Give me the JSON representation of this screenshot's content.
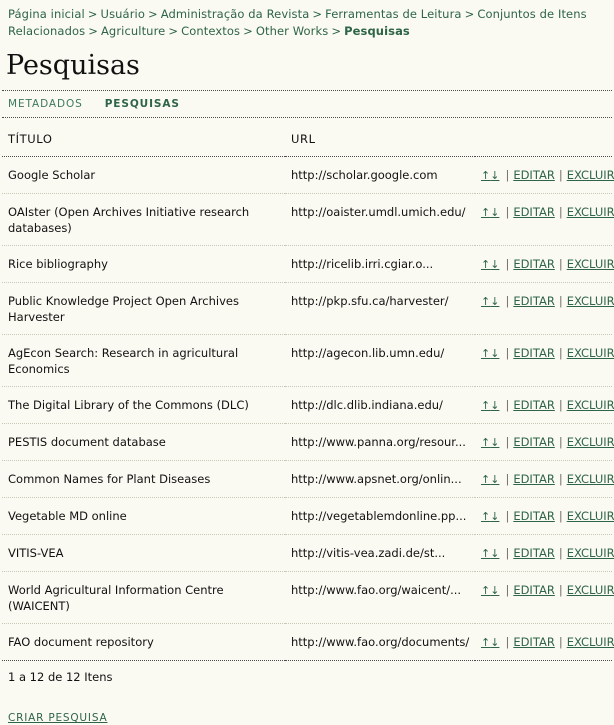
{
  "breadcrumb": {
    "separator": ">",
    "items": [
      {
        "label": "Página inicial",
        "current": false
      },
      {
        "label": "Usuário",
        "current": false
      },
      {
        "label": "Administração da Revista",
        "current": false
      },
      {
        "label": "Ferramentas de Leitura",
        "current": false
      },
      {
        "label": "Conjuntos de Itens Relacionados",
        "current": false
      },
      {
        "label": "Agriculture",
        "current": false
      },
      {
        "label": "Contextos",
        "current": false
      },
      {
        "label": "Other Works",
        "current": false
      },
      {
        "label": "Pesquisas",
        "current": true
      }
    ]
  },
  "page_title": "Pesquisas",
  "tabs": [
    {
      "label": "METADADOS",
      "active": false
    },
    {
      "label": "PESQUISAS",
      "active": true
    }
  ],
  "table": {
    "headers": {
      "title": "TÍTULO",
      "url": "URL",
      "actions": ""
    },
    "actions": {
      "up_arrow": "↑",
      "down_arrow": "↓",
      "separator": "|",
      "edit": "EDITAR",
      "delete": "EXCLUIR"
    },
    "rows": [
      {
        "title": "Google Scholar",
        "url": "http://scholar.google.com"
      },
      {
        "title": "OAIster (Open Archives Initiative research databases)",
        "url": "http://oaister.umdl.umich.edu/"
      },
      {
        "title": "Rice bibliography",
        "url": "http://ricelib.irri.cgiar.o..."
      },
      {
        "title": "Public Knowledge Project Open Archives Harvester",
        "url": "http://pkp.sfu.ca/harvester/"
      },
      {
        "title": "AgEcon Search: Research in agricultural Economics",
        "url": "http://agecon.lib.umn.edu/"
      },
      {
        "title": "The Digital Library of the Commons (DLC)",
        "url": "http://dlc.dlib.indiana.edu/"
      },
      {
        "title": "PESTIS document database",
        "url": "http://www.panna.org/resour..."
      },
      {
        "title": "Common Names for Plant Diseases",
        "url": "http://www.apsnet.org/onlin..."
      },
      {
        "title": "Vegetable MD online",
        "url": "http://vegetablemdonline.pp..."
      },
      {
        "title": "VITIS-VEA",
        "url": "http://vitis-vea.zadi.de/st..."
      },
      {
        "title": "World Agricultural Information Centre (WAICENT)",
        "url": "http://www.fao.org/waicent/..."
      },
      {
        "title": "FAO document repository",
        "url": "http://www.fao.org/documents/"
      }
    ]
  },
  "footer": {
    "item_count": "1 a 12 de 12 Itens",
    "create_link": "CRIAR PESQUISA"
  },
  "colors": {
    "background": "#fbfaf2",
    "link": "#2e6447",
    "text": "#111111",
    "rule_dark": "#4a4a4a",
    "rule_light": "#c9c7b8"
  }
}
